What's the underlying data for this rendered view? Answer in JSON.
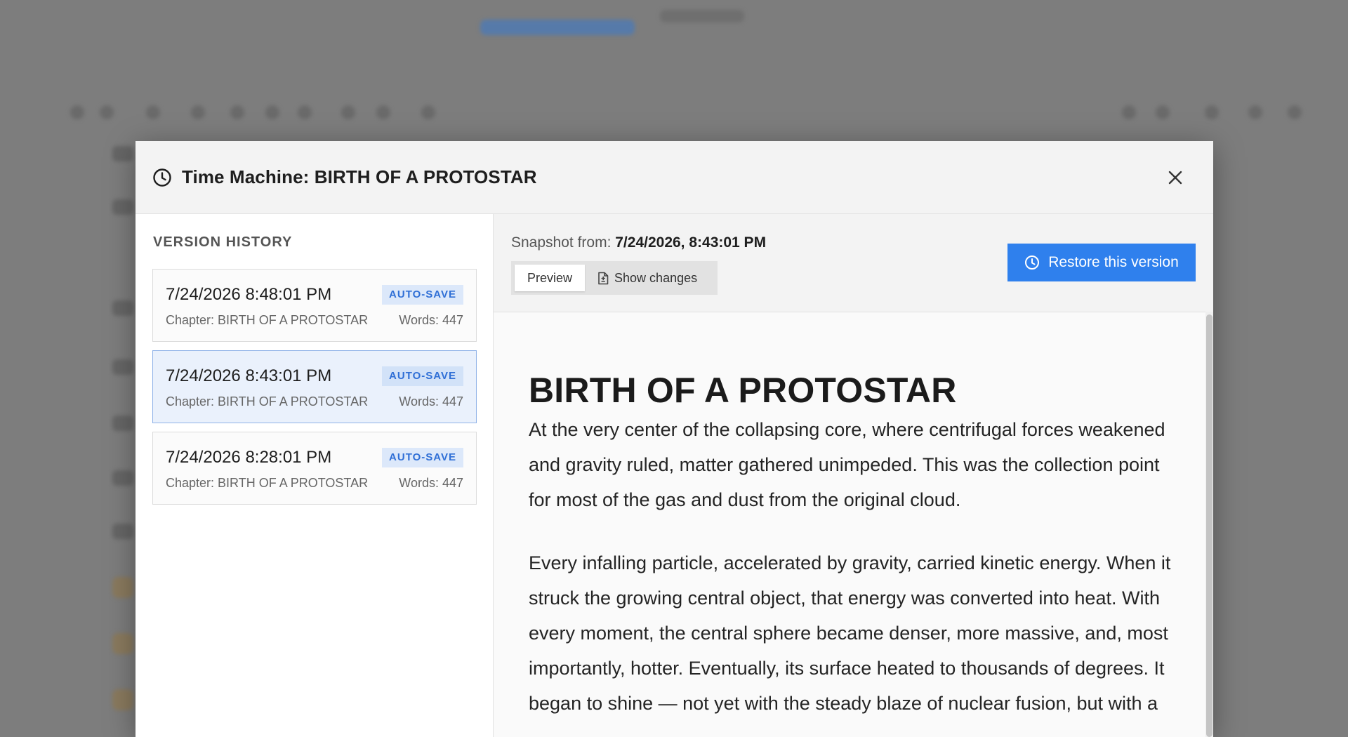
{
  "modal": {
    "title": "Time Machine: BIRTH OF A PROTOSTAR",
    "close_icon": "close-icon",
    "header_icon": "clock-icon"
  },
  "sidebar": {
    "title": "VERSION HISTORY",
    "versions": [
      {
        "date": "7/24/2026 8:48:01 PM",
        "badge": "AUTO-SAVE",
        "chapter": "Chapter: BIRTH OF A PROTOSTAR",
        "words": "Words: 447",
        "selected": false
      },
      {
        "date": "7/24/2026 8:43:01 PM",
        "badge": "AUTO-SAVE",
        "chapter": "Chapter: BIRTH OF A PROTOSTAR",
        "words": "Words: 447",
        "selected": true
      },
      {
        "date": "7/24/2026 8:28:01 PM",
        "badge": "AUTO-SAVE",
        "chapter": "Chapter: BIRTH OF A PROTOSTAR",
        "words": "Words: 447",
        "selected": false
      }
    ]
  },
  "snapshot": {
    "label": "Snapshot from:",
    "value": "7/24/2026, 8:43:01 PM"
  },
  "tabs": {
    "preview": "Preview",
    "show_changes": "Show changes"
  },
  "restore": {
    "label": "Restore this version"
  },
  "document": {
    "title": "BIRTH OF A PROTOSTAR",
    "paragraphs": [
      "At the very center of the collapsing core, where centrifugal forces weakened and gravity ruled, matter gathered unimpeded. This was the collection point for most of the gas and dust from the original cloud.",
      "Every infalling particle, accelerated by gravity, carried kinetic energy. When it struck the growing central object, that energy was converted into heat. With every moment, the central sphere became denser, more massive, and, most importantly, hotter. Eventually, its surface heated to thousands of degrees. It began to shine — not yet with the steady blaze of nuclear fusion, but with a"
    ]
  },
  "colors": {
    "accent": "#2f80ed",
    "badge_bg": "#dce8fa",
    "badge_text": "#2f6fd6",
    "selected_bg": "#eaf1fc"
  }
}
